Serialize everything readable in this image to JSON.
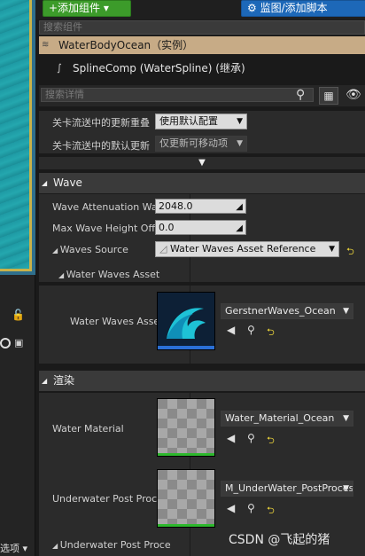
{
  "toolbar": {
    "add_component": "+添加组件 ▾",
    "blueprint": "⚙ 监图/添加脚本"
  },
  "components": {
    "search_placeholder": "搜索组件",
    "root": "WaterBodyOcean（实例）",
    "child": "SplineComp (WaterSpline) (继承)"
  },
  "details": {
    "search_placeholder": "搜索详情"
  },
  "streaming": {
    "row1_label": "关卡流送中的更新重叠",
    "row1_value": "使用默认配置",
    "row2_label": "关卡流送中的默认更新",
    "row2_value": "仅更新可移动项"
  },
  "wave": {
    "header": "Wave",
    "attenuation_label": "Wave Attenuation Wat",
    "attenuation_value": "2048.0",
    "max_height_label": "Max Wave Height Offs",
    "max_height_value": "0.0",
    "source_label": "Waves Source",
    "source_value": "Water Waves Asset Reference",
    "asset_sub": "Water Waves Asset",
    "asset_label": "Water Waves Asse",
    "asset_value": "GerstnerWaves_Ocean"
  },
  "render": {
    "header": "渲染",
    "material_label": "Water Material",
    "material_value": "Water_Material_Ocean",
    "underwater_label": "Underwater Post Proce",
    "underwater_value": "M_UnderWater_PostProces",
    "underwater_label2": "Underwater Post Proce"
  },
  "left": {
    "options": "选项 ▾"
  },
  "watermark": "CSDN @飞起的猪"
}
